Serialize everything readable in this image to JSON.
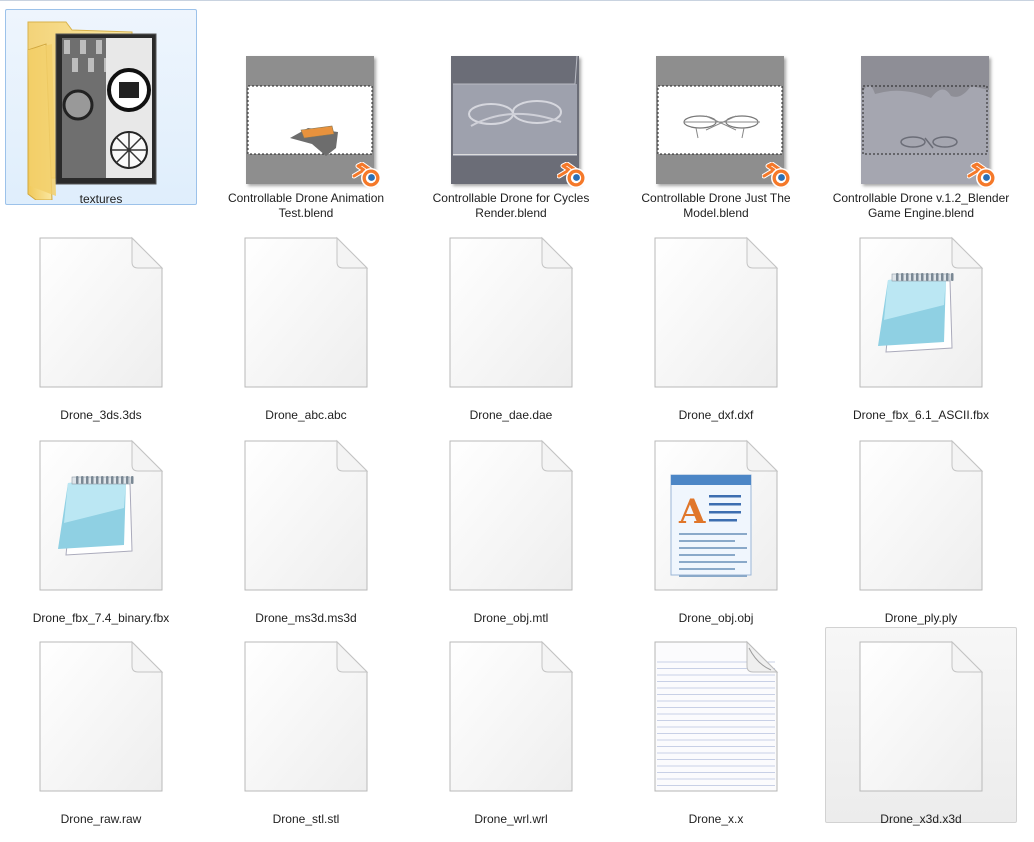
{
  "items": [
    {
      "kind": "folder",
      "label": "textures",
      "selected": true
    },
    {
      "kind": "blend",
      "variant": "anim",
      "label": "Controllable Drone Animation Test.blend"
    },
    {
      "kind": "blend",
      "variant": "cycles",
      "label": "Controllable Drone for Cycles Render.blend"
    },
    {
      "kind": "blend",
      "variant": "model",
      "label": "Controllable Drone Just The Model.blend"
    },
    {
      "kind": "blend",
      "variant": "bge",
      "label": "Controllable Drone v.1.2_Blender Game Engine.blend"
    },
    {
      "kind": "blank",
      "label": "Drone_3ds.3ds"
    },
    {
      "kind": "blank",
      "label": "Drone_abc.abc"
    },
    {
      "kind": "blank",
      "label": "Drone_dae.dae"
    },
    {
      "kind": "blank",
      "label": "Drone_dxf.dxf"
    },
    {
      "kind": "notepad",
      "label": "Drone_fbx_6.1_ASCII.fbx"
    },
    {
      "kind": "notepad",
      "label": "Drone_fbx_7.4_binary.fbx"
    },
    {
      "kind": "blank",
      "label": "Drone_ms3d.ms3d"
    },
    {
      "kind": "blank",
      "label": "Drone_obj.mtl"
    },
    {
      "kind": "wordpad",
      "label": "Drone_obj.obj"
    },
    {
      "kind": "blank",
      "label": "Drone_ply.ply"
    },
    {
      "kind": "blank",
      "label": "Drone_raw.raw"
    },
    {
      "kind": "blank",
      "label": "Drone_stl.stl"
    },
    {
      "kind": "blank",
      "label": "Drone_wrl.wrl"
    },
    {
      "kind": "text",
      "label": "Drone_x.x"
    },
    {
      "kind": "blank",
      "label": "Drone_x3d.x3d",
      "hover": true
    }
  ],
  "colors": {
    "selection": "#cce8ff",
    "blender_orange": "#f5792a"
  }
}
